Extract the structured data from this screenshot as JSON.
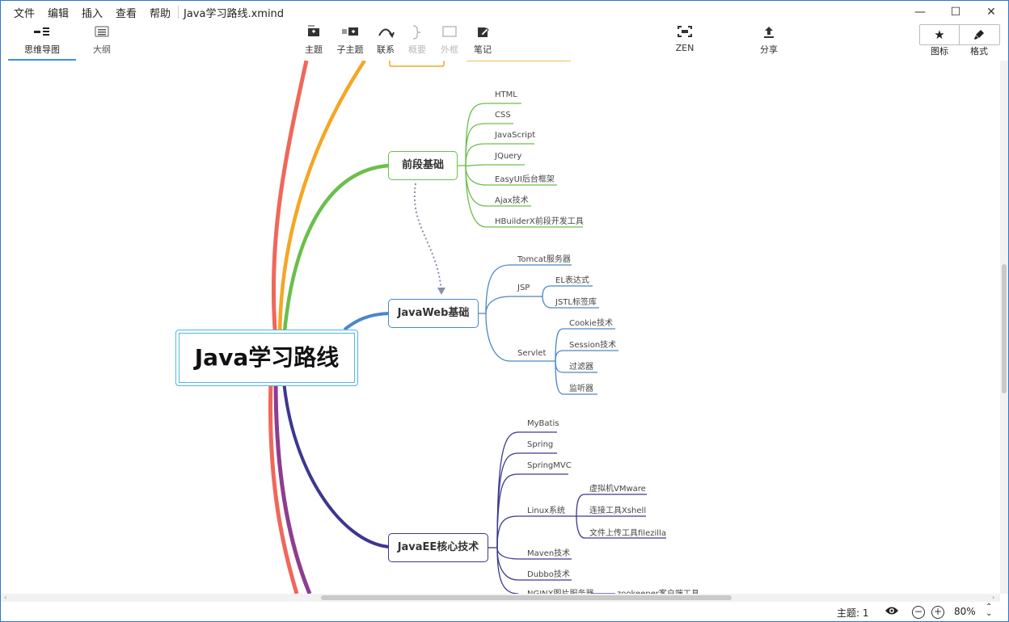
{
  "menu": {
    "items": [
      "文件",
      "编辑",
      "插入",
      "查看",
      "帮助"
    ],
    "doc_title": "Java学习路线.xmind"
  },
  "window_controls": {
    "minimize": "—",
    "maximize": "☐",
    "close": "✕"
  },
  "toolbar": {
    "views": [
      {
        "label": "思维导图",
        "icon": "mindmap-icon",
        "active": true
      },
      {
        "label": "大纲",
        "icon": "outline-icon",
        "active": false
      }
    ],
    "tools": [
      {
        "label": "主题",
        "icon": "topic-icon",
        "enabled": true
      },
      {
        "label": "子主题",
        "icon": "subtopic-icon",
        "enabled": true
      },
      {
        "label": "联系",
        "icon": "relationship-icon",
        "enabled": true
      },
      {
        "label": "概要",
        "icon": "summary-icon",
        "enabled": false
      },
      {
        "label": "外框",
        "icon": "boundary-icon",
        "enabled": false
      },
      {
        "label": "笔记",
        "icon": "notes-icon",
        "enabled": true
      }
    ],
    "zen": {
      "label": "ZEN",
      "icon": "zen-icon"
    },
    "share": {
      "label": "分享",
      "icon": "share-icon"
    },
    "icon_panel": {
      "label": "图标",
      "icon": "star-icon"
    },
    "format_panel": {
      "label": "格式",
      "icon": "brush-icon"
    }
  },
  "map": {
    "central": "Java学习路线",
    "colors": {
      "frontend": "#6abf4b",
      "javaweb": "#4a86c8",
      "javaee": "#3d3790",
      "central_border": "#4fb9e0",
      "orange": "#f5a623",
      "red": "#f0675a",
      "purple": "#8e3d8e"
    },
    "frontend": {
      "title": "前段基础",
      "children": [
        "HTML",
        "CSS",
        "JavaScript",
        "JQuery",
        "EasyUI后台框架",
        "Ajax技术",
        "HBuilderX前段开发工具"
      ]
    },
    "javaweb": {
      "title": "JavaWeb基础",
      "tomcat": "Tomcat服务器",
      "jsp": {
        "label": "JSP",
        "children": [
          "EL表达式",
          "JSTL标签库"
        ]
      },
      "servlet": {
        "label": "Servlet",
        "children": [
          "Cookie技术",
          "Session技术",
          "过滤器",
          "监听器"
        ]
      }
    },
    "javaee": {
      "title": "JavaEE核心技术",
      "children": [
        "MyBatis",
        "Spring",
        "SpringMVC",
        "Linux系统",
        "Maven技术",
        "Dubbo技术",
        "NGINX图片服务器"
      ],
      "linux_children": [
        "虚拟机VMware",
        "连接工具Xshell",
        "文件上传工具filezilla"
      ],
      "extra": "zookeeper客户端工具"
    }
  },
  "status": {
    "topic_count": "主题: 1",
    "zoom": "80%",
    "zoom_out": "−",
    "zoom_in": "+"
  }
}
